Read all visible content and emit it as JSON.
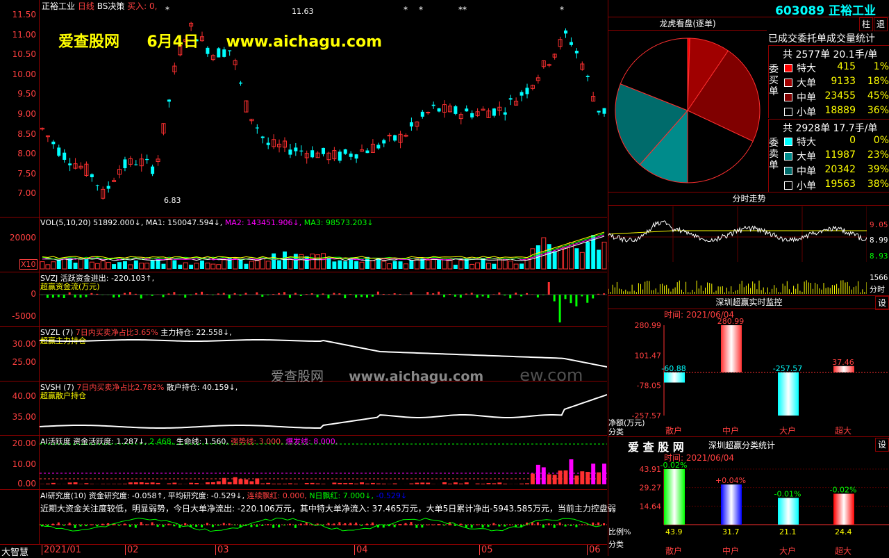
{
  "watermarks": {
    "brand": "爱查股网",
    "date": "6月4日",
    "url": "www.aichagu.com",
    "mid_brand": "爱查股网",
    "mid_url": "www.aichagu.com",
    "ghost": "ew.com"
  },
  "kline": {
    "title_stock": "正裕工业",
    "title_period": "日线",
    "title_indicator": "BS决策",
    "title_buy": "买入: 0,",
    "y_ticks": [
      "11.50",
      "11.00",
      "10.50",
      "10.00",
      "9.50",
      "9.00",
      "8.50",
      "8.00",
      "7.50",
      "7.00"
    ],
    "high_label": "11.63",
    "low_label": "6.83"
  },
  "vol": {
    "header": "VOL(5,10,20) 51892.000↓, MA1: 150047.594↓, MA2: 143451.906↓, MA3: 98573.203↓",
    "parts": [
      "VOL(5,10,20) 51892.000↓,",
      "MA1: 150047.594↓,",
      "MA2: 143451.906↓,",
      "MA3: 98573.203↓"
    ],
    "y_ticks": [
      "20000"
    ],
    "unit": "X10"
  },
  "svzj": {
    "name": "SVZJ",
    "title": "活跃资金进出: -220.103↑,",
    "subtitle": "超赢资金流(万元)",
    "y_ticks": [
      "0",
      "-5000"
    ]
  },
  "svzl": {
    "name": "SVZL (7)",
    "pct": "7日内买卖净占比3.65%",
    "hold": "主力持仓: 22.558↓,",
    "subtitle": "超赢主力持仓",
    "y_ticks": [
      "30.00",
      "25.00"
    ]
  },
  "svsh": {
    "name": "SVSH (7)",
    "pct": "7日内买卖净占比2.782%",
    "hold": "散户持仓: 40.159↓,",
    "subtitle": "超赢散户持仓",
    "y_ticks": [
      "40.00",
      "35.00"
    ]
  },
  "ai_active": {
    "title": "AI活跃度 资金活跃度: 1.287↓,",
    "v2": "2.468,",
    "life": "生命线: 1.560,",
    "strong": "强势线: 3.000,",
    "burst": "爆发线: 8.000,",
    "y_ticks": [
      "20.00",
      "10.00",
      "0.00"
    ]
  },
  "ai_research": {
    "title": "AI研究度(10) 资金研究度: -0.058↑,",
    "avg": "平均研究度: -0.529↓,",
    "lianxu": "连续飘红: 0.000,",
    "nday": "N日飘红: 7.000↓,",
    "last": "-0.529↓",
    "comment": "近期大资金关注度较低，明显弱势，今日大单净流出: -220.106万元，其中特大单净流入: 37.465万元，大单5日累计净出-5943.585万元，当前主力控盘弱"
  },
  "bottom": {
    "brand": "大智慧",
    "dates": [
      "2021/01",
      "02",
      "03",
      "04",
      "05",
      "06"
    ]
  },
  "right": {
    "code": "603089",
    "name": "正裕工业",
    "btn_zhu": "柱",
    "btn_tui": "退",
    "dragon_title": "龙虎看盘(逐单)",
    "stats_title": "已成交委托单成交量统计",
    "buy": {
      "side_label": "委买单",
      "total": "共 2577单 20.1手/单",
      "rows": [
        {
          "label": "特大",
          "value": "415",
          "pct": "1%",
          "color": "#ff0000"
        },
        {
          "label": "大单",
          "value": "9133",
          "pct": "18%",
          "color": "#a00000"
        },
        {
          "label": "中单",
          "value": "23455",
          "pct": "45%",
          "color": "#800000"
        },
        {
          "label": "小单",
          "value": "18889",
          "pct": "36%",
          "color": "#000000"
        }
      ]
    },
    "sell": {
      "side_label": "委卖单",
      "total": "共 2928单 17.7手/单",
      "rows": [
        {
          "label": "特大",
          "value": "0",
          "pct": "0%",
          "color": "#00ffff"
        },
        {
          "label": "大单",
          "value": "11987",
          "pct": "23%",
          "color": "#008b8b"
        },
        {
          "label": "中单",
          "value": "20342",
          "pct": "39%",
          "color": "#006b6b"
        },
        {
          "label": "小单",
          "value": "19563",
          "pct": "38%",
          "color": "#000000"
        }
      ]
    },
    "intraday": {
      "title": "分时走势",
      "y_ticks": [
        "9.05",
        "8.99",
        "8.93"
      ],
      "vol_label": "1566",
      "time_label": "分时"
    },
    "monitor": {
      "title": "深圳超赢实时监控",
      "set": "设",
      "time": "时间: 2021/06/04",
      "y_ticks": [
        "280.99",
        "101.47",
        "-78.05",
        "-257.57"
      ],
      "bars": [
        {
          "label": "散户",
          "value": "-60.88",
          "num": -60.88
        },
        {
          "label": "中户",
          "value": "280.99",
          "num": 280.99
        },
        {
          "label": "大户",
          "value": "-257.57",
          "num": -257.57
        },
        {
          "label": "超大",
          "value": "37.46",
          "num": 37.46
        }
      ],
      "ylabel": "净额(万元)",
      "xlabel": "分类"
    },
    "classify": {
      "brand": "爱 查 股 网",
      "title": "深圳超赢分类统计",
      "set": "设",
      "time": "时间: 2021/06/04",
      "y_ticks": [
        "43.91",
        "29.27",
        "14.64"
      ],
      "bars": [
        {
          "label": "散户",
          "top": "-0.02%",
          "bottom": "43.9",
          "num": 43.9,
          "color": "#00ff00",
          "topcolor": "#00ff00"
        },
        {
          "label": "中户",
          "top": "+0.04%",
          "bottom": "31.7",
          "num": 31.7,
          "color": "#0000ff",
          "topcolor": "#ff4040"
        },
        {
          "label": "大户",
          "top": "-0.01%",
          "bottom": "21.1",
          "num": 21.1,
          "color": "#00ffff",
          "topcolor": "#00ff00"
        },
        {
          "label": "超大",
          "top": "-0.02%",
          "bottom": "24.4",
          "num": 24.4,
          "color": "#ff0000",
          "topcolor": "#00ff00"
        }
      ],
      "ylabel": "比例%",
      "xlabel": "分类"
    }
  }
}
